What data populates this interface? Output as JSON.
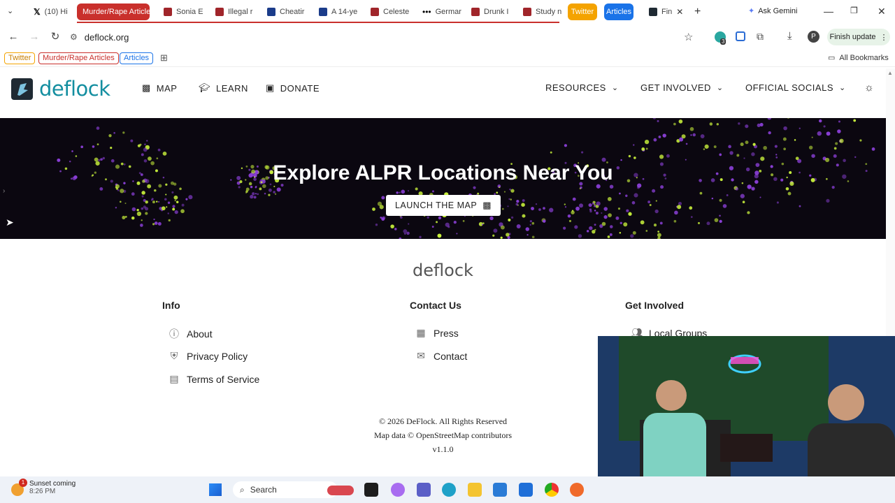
{
  "browser": {
    "tabs": [
      {
        "label": "(10) Hi",
        "icon": "x-logo-icon"
      },
      {
        "label": "Murder/Rape Articles",
        "group": "red"
      },
      {
        "label": "Sonia E"
      },
      {
        "label": "Illegal r"
      },
      {
        "label": "Cheatir"
      },
      {
        "label": "A 14-ye"
      },
      {
        "label": "Celeste"
      },
      {
        "label": "Germar"
      },
      {
        "label": "Drunk I"
      },
      {
        "label": "Study n"
      },
      {
        "label": "Twitter",
        "group": "orange"
      },
      {
        "label": "Articles",
        "group": "blue"
      },
      {
        "label": "Fin",
        "active": true
      }
    ],
    "ask_gemini": "Ask Gemini",
    "url": "deflock.org",
    "finish_update": "Finish update",
    "extension_badge": "3",
    "profile_initial": "P",
    "bookmarks": [
      {
        "label": "Twitter",
        "color": "#f4a300"
      },
      {
        "label": "Murder/Rape Articles",
        "color": "#c9302c"
      },
      {
        "label": "Articles",
        "color": "#1a73e8"
      }
    ],
    "all_bookmarks": "All Bookmarks"
  },
  "site": {
    "logo": "deflock",
    "nav_left": [
      {
        "label": "MAP",
        "icon": "map-icon"
      },
      {
        "label": "LEARN",
        "icon": "graduation-cap-icon"
      },
      {
        "label": "DONATE",
        "icon": "donate-icon"
      }
    ],
    "nav_right": [
      {
        "label": "RESOURCES"
      },
      {
        "label": "GET INVOLVED"
      },
      {
        "label": "OFFICIAL SOCIALS"
      }
    ]
  },
  "hero": {
    "title": "Explore ALPR Locations Near You",
    "button": "LAUNCH THE MAP"
  },
  "footer": {
    "logo": "deflock",
    "columns": [
      {
        "title": "Info",
        "links": [
          {
            "label": "About",
            "icon": "info-icon"
          },
          {
            "label": "Privacy Policy",
            "icon": "shield-icon"
          },
          {
            "label": "Terms of Service",
            "icon": "document-icon"
          }
        ]
      },
      {
        "title": "Contact Us",
        "links": [
          {
            "label": "Press",
            "icon": "newspaper-icon"
          },
          {
            "label": "Contact",
            "icon": "envelope-icon"
          }
        ]
      },
      {
        "title": "Get Involved",
        "links": [
          {
            "label": "Local Groups",
            "icon": "people-icon"
          }
        ]
      }
    ],
    "copyright": "© 2026 DeFlock. All Rights Reserved",
    "map_data": "Map data © OpenStreetMap contributors",
    "version": "v1.1.0"
  },
  "taskbar": {
    "weather_title": "Sunset coming",
    "weather_time": "8:26 PM",
    "notification_count": "1",
    "search": "Search"
  },
  "colors": {
    "brand": "#138ea0",
    "hero_bg": "#0b0710",
    "dot_yellow": "#c8f03c"
  }
}
